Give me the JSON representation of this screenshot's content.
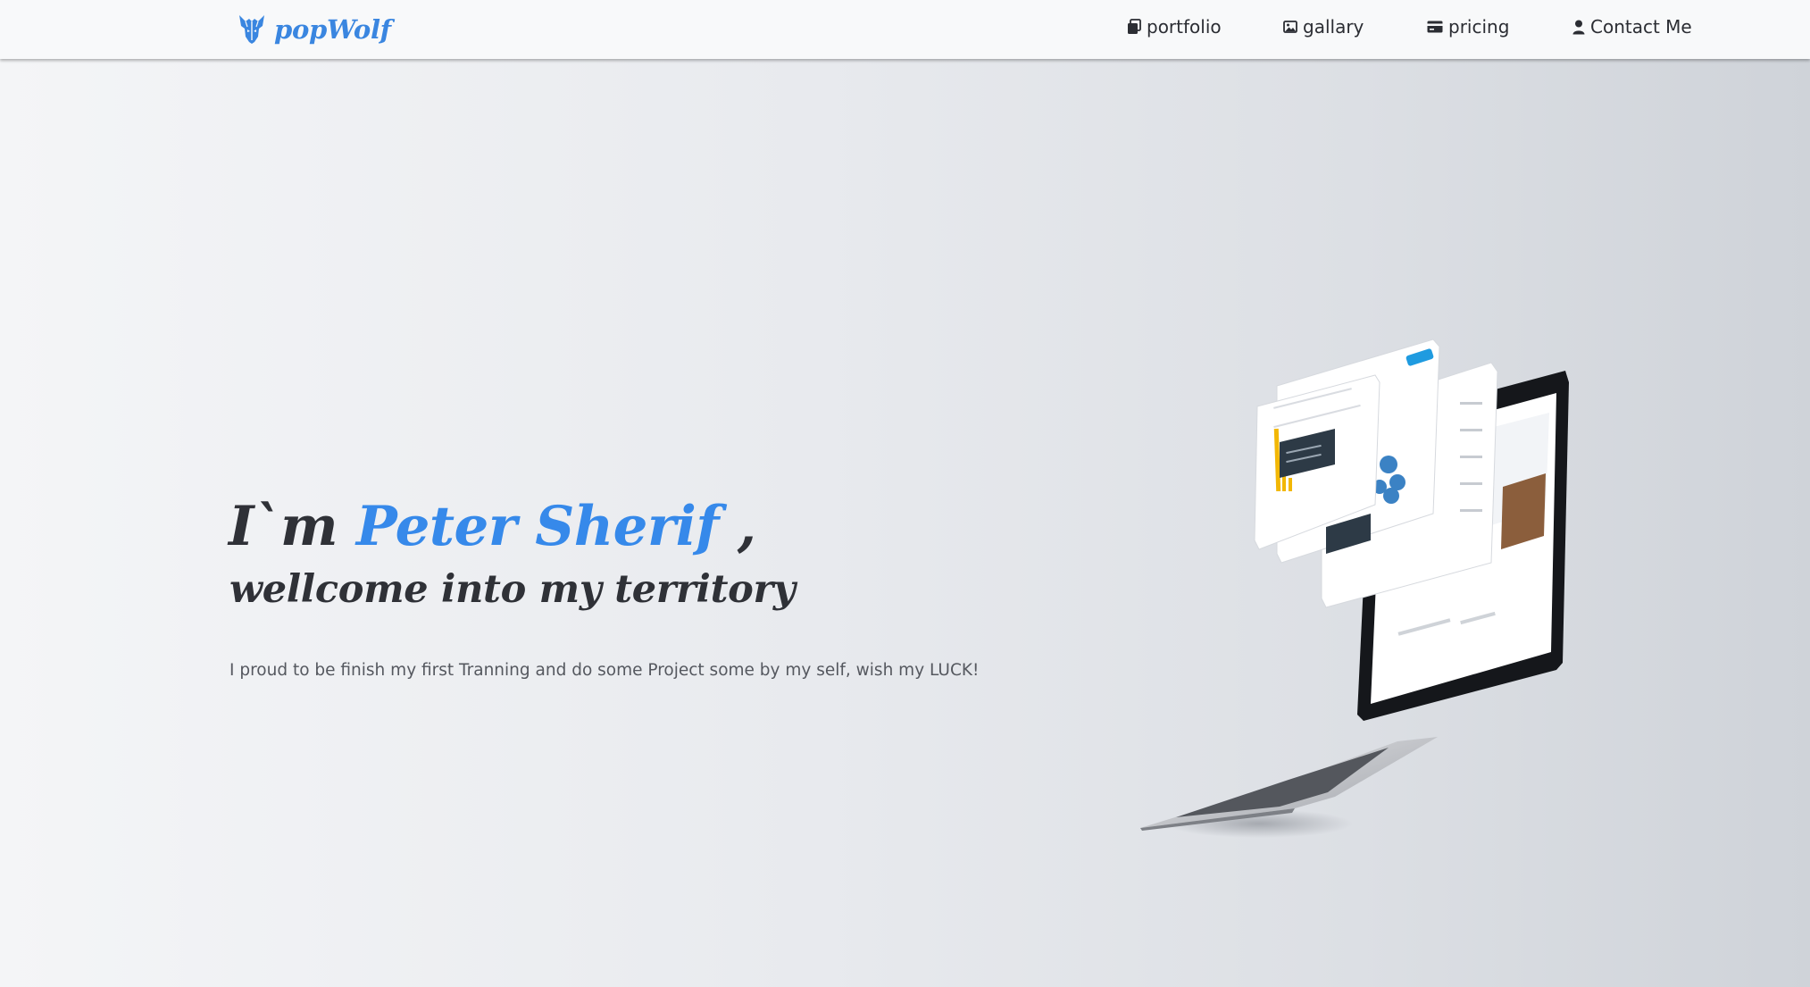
{
  "brand": {
    "name": "popWolf",
    "logo_icon": "wolf-logo-icon",
    "accent_color": "#3a86e0"
  },
  "nav": {
    "items": [
      {
        "label": "portfolio",
        "icon": "portfolio-icon"
      },
      {
        "label": "gallary",
        "icon": "image-icon"
      },
      {
        "label": "pricing",
        "icon": "credit-card-icon"
      },
      {
        "label": "Contact Me",
        "icon": "user-icon"
      }
    ]
  },
  "hero": {
    "greeting": "I`m",
    "name": "Peter Sherif",
    "comma": ",",
    "subtitle": "wellcome into my territory",
    "text": "I proud to be finish my first Tranning and do some Project some by my self, wish my LUCK!",
    "name_color": "#3689ea",
    "illustration_icon": "laptop-dashboard-illustration"
  }
}
